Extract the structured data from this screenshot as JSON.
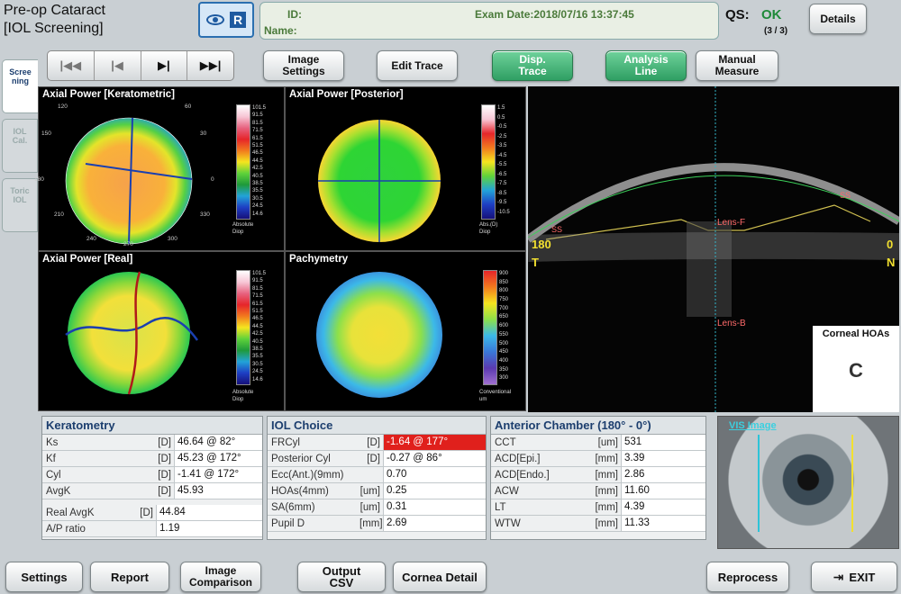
{
  "header": {
    "title1": "Pre-op Cataract",
    "title2": "[IOL Screening]",
    "eye": "R",
    "id_label": "ID:",
    "name_label": "Name:",
    "exam_date": "Exam Date:2018/07/16 13:37:45",
    "qs_label": "QS:",
    "qs_value": "OK",
    "qs_count": "(3 / 3)",
    "details": "Details"
  },
  "sidetabs": [
    "Scree\nning",
    "IOL\nCal.",
    "Toric\nIOL"
  ],
  "toolbar": {
    "nav": [
      "|◀◀",
      "|◀",
      "▶|",
      "▶▶|"
    ],
    "image_settings": "Image\nSettings",
    "edit_trace": "Edit Trace",
    "disp_trace": "Disp.\nTrace",
    "analysis_line": "Analysis\nLine",
    "manual_measure": "Manual\nMeasure"
  },
  "maps": [
    {
      "title": "Axial Power [Keratometric]",
      "legend": "Absolute\nDiop",
      "scale": [
        "101.5",
        "91.5",
        "81.5",
        "71.5",
        "61.5",
        "51.5",
        "46.5",
        "44.5",
        "42.5",
        "40.5",
        "38.5",
        "35.5",
        "30.5",
        "24.5",
        "14.6"
      ]
    },
    {
      "title": "Axial Power [Posterior]",
      "legend": "Abs.(D)\nDiop",
      "scale": [
        "1.5",
        "0.5",
        "-0.5",
        "-2.5",
        "-3.5",
        "-4.5",
        "-5.5",
        "-6.5",
        "-7.5",
        "-8.5",
        "-9.5",
        "-10.5"
      ]
    },
    {
      "title": "Axial Power [Real]",
      "legend": "Absolute\nDiop",
      "scale": [
        "101.5",
        "91.5",
        "81.5",
        "71.5",
        "61.5",
        "51.5",
        "46.5",
        "44.5",
        "42.5",
        "40.5",
        "38.5",
        "35.5",
        "30.5",
        "24.5",
        "14.6"
      ]
    },
    {
      "title": "Pachymetry",
      "legend": "Conventional\num",
      "scale": [
        "900",
        "850",
        "800",
        "750",
        "700",
        "650",
        "600",
        "550",
        "500",
        "450",
        "400",
        "350",
        "300"
      ]
    }
  ],
  "angles": {
    "a120": "120",
    "a90": "90",
    "a60": "60",
    "a150": "150",
    "a30": "30",
    "a180": "180",
    "a0": "0",
    "a210": "210",
    "a330": "330",
    "a240": "240",
    "a270": "270",
    "a300": "300"
  },
  "oct": {
    "lens_f": "Lens-F",
    "lens_b": "Lens-B",
    "left_deg": "180",
    "right_deg": "0",
    "left_side": "T",
    "right_side": "N",
    "marker": "SS",
    "hoas_title": "Corneal HOAs",
    "hoas_glyph": "C"
  },
  "keratometry": {
    "title": "Keratometry",
    "rows": [
      [
        "Ks",
        "[D]",
        "46.64 @ 82°"
      ],
      [
        "Kf",
        "[D]",
        "45.23 @ 172°"
      ],
      [
        "Cyl",
        "[D]",
        "-1.41 @ 172°"
      ],
      [
        "AvgK",
        "[D]",
        "45.93"
      ]
    ],
    "rows2": [
      [
        "Real AvgK",
        "[D]",
        "44.84"
      ],
      [
        "A/P ratio",
        "",
        "1.19"
      ]
    ]
  },
  "iol": {
    "title": "IOL Choice",
    "rows": [
      [
        "FRCyl",
        "[D]",
        "-1.64 @ 177°"
      ],
      [
        "Posterior Cyl",
        "[D]",
        "-0.27 @ 86°"
      ],
      [
        "Ecc(Ant.)(9mm)",
        "",
        "0.70"
      ],
      [
        "HOAs(4mm)",
        "[um]",
        "0.25"
      ],
      [
        "SA(6mm)",
        "[um]",
        "0.31"
      ],
      [
        "Pupil D",
        "[mm]",
        "2.69"
      ]
    ]
  },
  "chamber": {
    "title": "Anterior Chamber (180° - 0°)",
    "rows": [
      [
        "CCT",
        "[um]",
        "531"
      ],
      [
        "ACD[Epi.]",
        "[mm]",
        "3.39"
      ],
      [
        "ACD[Endo.]",
        "[mm]",
        "2.86"
      ],
      [
        "ACW",
        "[mm]",
        "11.60"
      ],
      [
        "LT",
        "[mm]",
        "4.39"
      ],
      [
        "WTW",
        "[mm]",
        "11.33"
      ]
    ]
  },
  "vis": {
    "title": "VIS Image"
  },
  "bottom": {
    "settings": "Settings",
    "report": "Report",
    "image_comparison": "Image\nComparison",
    "output_csv": "Output\nCSV",
    "cornea_detail": "Cornea Detail",
    "reprocess": "Reprocess",
    "exit": "EXIT"
  },
  "colors": {
    "accent_green": "#2f9f63",
    "highlight_red": "#e0201c",
    "title_blue": "#1c3e6e"
  }
}
